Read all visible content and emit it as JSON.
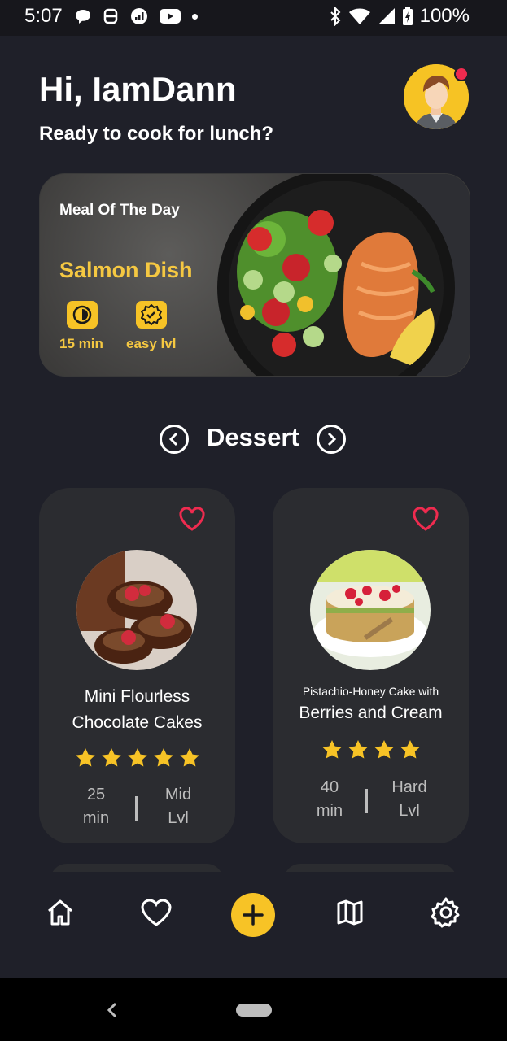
{
  "status_bar": {
    "time": "5:07",
    "battery": "100%"
  },
  "header": {
    "greeting": "Hi, IamDann",
    "subtitle": "Ready to cook for lunch?"
  },
  "meal_of_day": {
    "label": "Meal Of The Day",
    "title": "Salmon Dish",
    "time": "15 min",
    "level": "easy lvl"
  },
  "category": {
    "title": "Dessert"
  },
  "recipes": [
    {
      "name_line1": "Mini Flourless",
      "name_line2": "Chocolate Cakes",
      "rating": 5,
      "time_value": "25",
      "time_unit": "min",
      "level_value": "Mid",
      "level_unit": "Lvl"
    },
    {
      "name_line1": "Pistachio-Honey Cake with",
      "name_line2": "Berries and Cream",
      "rating": 4,
      "time_value": "40",
      "time_unit": "min",
      "level_value": "Hard",
      "level_unit": "Lvl"
    }
  ],
  "colors": {
    "accent": "#f7c326",
    "heart": "#ef2b4f",
    "background": "#1f2029",
    "card": "#2b2c30"
  },
  "nav": {
    "items": [
      "home-icon",
      "heart-icon",
      "add-icon",
      "map-icon",
      "settings-icon"
    ]
  }
}
